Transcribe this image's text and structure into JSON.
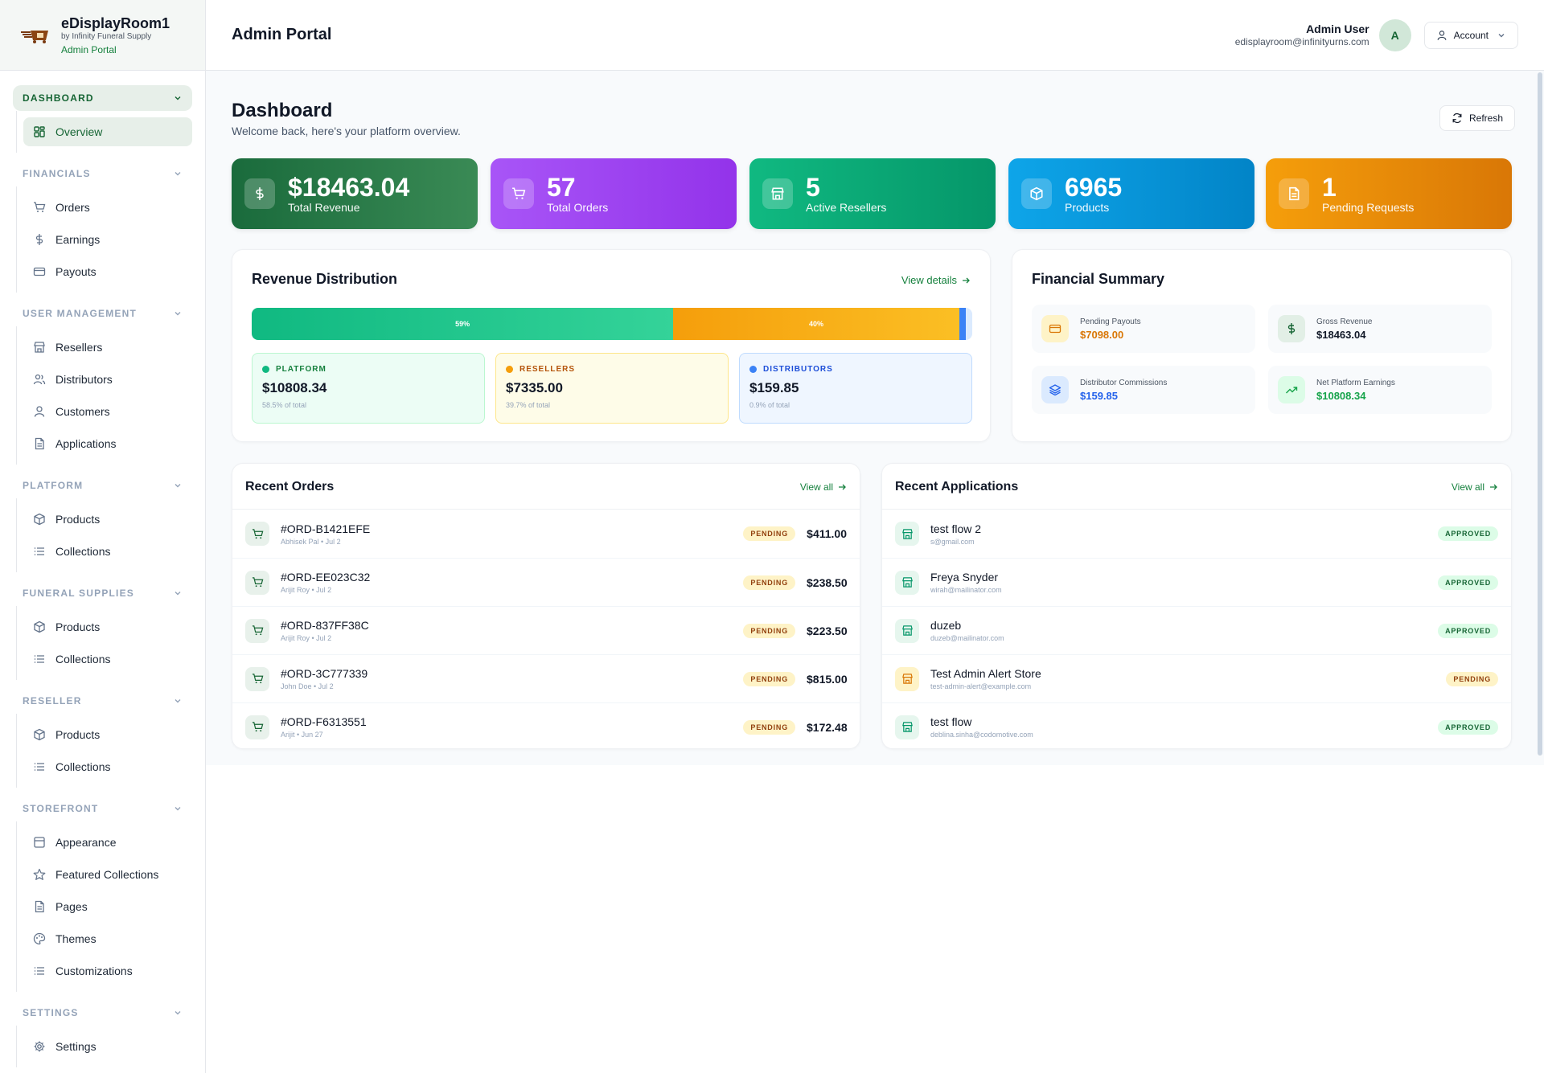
{
  "brand": {
    "title": "eDisplayRoom1",
    "subtitle": "by Infinity Funeral Supply",
    "portal": "Admin Portal"
  },
  "sidebar": {
    "groups": [
      {
        "title": "DASHBOARD",
        "items": [
          {
            "label": "Overview",
            "icon": "grid-icon"
          }
        ]
      },
      {
        "title": "FINANCIALS",
        "items": [
          {
            "label": "Orders",
            "icon": "cart-icon"
          },
          {
            "label": "Earnings",
            "icon": "dollar-icon"
          },
          {
            "label": "Payouts",
            "icon": "card-icon"
          }
        ]
      },
      {
        "title": "USER MANAGEMENT",
        "items": [
          {
            "label": "Resellers",
            "icon": "store-icon"
          },
          {
            "label": "Distributors",
            "icon": "users-icon"
          },
          {
            "label": "Customers",
            "icon": "user-icon"
          },
          {
            "label": "Applications",
            "icon": "document-icon"
          }
        ]
      },
      {
        "title": "PLATFORM",
        "items": [
          {
            "label": "Products",
            "icon": "box-icon"
          },
          {
            "label": "Collections",
            "icon": "list-icon"
          }
        ]
      },
      {
        "title": "FUNERAL SUPPLIES",
        "items": [
          {
            "label": "Products",
            "icon": "box-icon"
          },
          {
            "label": "Collections",
            "icon": "list-icon"
          }
        ]
      },
      {
        "title": "RESELLER",
        "items": [
          {
            "label": "Products",
            "icon": "box-icon"
          },
          {
            "label": "Collections",
            "icon": "list-icon"
          }
        ]
      },
      {
        "title": "STOREFRONT",
        "items": [
          {
            "label": "Appearance",
            "icon": "layout-icon"
          },
          {
            "label": "Featured Collections",
            "icon": "star-icon"
          },
          {
            "label": "Pages",
            "icon": "document-icon"
          },
          {
            "label": "Themes",
            "icon": "palette-icon"
          },
          {
            "label": "Customizations",
            "icon": "list-icon"
          }
        ]
      },
      {
        "title": "SETTINGS",
        "items": [
          {
            "label": "Settings",
            "icon": "gear-icon"
          }
        ]
      }
    ]
  },
  "header": {
    "title": "Admin Portal",
    "user_name": "Admin User",
    "user_email": "edisplayroom@infinityurns.com",
    "avatar_initial": "A",
    "account_label": "Account"
  },
  "page": {
    "title": "Dashboard",
    "subtitle": "Welcome back, here's your platform overview.",
    "refresh_label": "Refresh"
  },
  "stats": [
    {
      "value": "$18463.04",
      "label": "Total Revenue",
      "icon": "dollar-icon",
      "color": "#1f7a45"
    },
    {
      "value": "57",
      "label": "Total Orders",
      "icon": "cart-icon",
      "color": "#9333ea"
    },
    {
      "value": "5",
      "label": "Active Resellers",
      "icon": "store-icon",
      "color": "#10b981"
    },
    {
      "value": "6965",
      "label": "Products",
      "icon": "box-icon",
      "color": "#0ea5e9"
    },
    {
      "value": "1",
      "label": "Pending Requests",
      "icon": "document-icon",
      "color": "#f59e0b"
    }
  ],
  "revenue_distribution": {
    "title": "Revenue Distribution",
    "link": "View details",
    "segments": [
      {
        "label": "59%",
        "fraction": 0.585,
        "color": "#10b981"
      },
      {
        "label": "40%",
        "fraction": 0.397,
        "color": "#f59e0b"
      },
      {
        "label": "",
        "fraction": 0.009,
        "color": "#3b82f6"
      }
    ],
    "boxes": [
      {
        "title": "PLATFORM",
        "amount": "$10808.34",
        "pct": "58.5% of total",
        "color": "#10b981"
      },
      {
        "title": "RESELLERS",
        "amount": "$7335.00",
        "pct": "39.7% of total",
        "color": "#f59e0b"
      },
      {
        "title": "DISTRIBUTORS",
        "amount": "$159.85",
        "pct": "0.9% of total",
        "color": "#3b82f6"
      }
    ]
  },
  "financial_summary": {
    "title": "Financial Summary",
    "items": [
      {
        "label": "Pending Payouts",
        "value": "$7098.00",
        "icon": "card-icon",
        "color": "#d97706"
      },
      {
        "label": "Gross Revenue",
        "value": "$18463.04",
        "icon": "dollar-icon",
        "color": "#111827"
      },
      {
        "label": "Distributor Commissions",
        "value": "$159.85",
        "icon": "layers-icon",
        "color": "#2563eb"
      },
      {
        "label": "Net Platform Earnings",
        "value": "$10808.34",
        "icon": "trending-up-icon",
        "color": "#16a34a"
      }
    ]
  },
  "recent_orders": {
    "title": "Recent Orders",
    "link": "View all",
    "rows": [
      {
        "id": "#ORD-B1421EFE",
        "meta": "Abhisek Pal • Jul 2",
        "status": "PENDING",
        "amount": "$411.00"
      },
      {
        "id": "#ORD-EE023C32",
        "meta": "Arijit Roy • Jul 2",
        "status": "PENDING",
        "amount": "$238.50"
      },
      {
        "id": "#ORD-837FF38C",
        "meta": "Arijit Roy • Jul 2",
        "status": "PENDING",
        "amount": "$223.50"
      },
      {
        "id": "#ORD-3C777339",
        "meta": "John Doe • Jul 2",
        "status": "PENDING",
        "amount": "$815.00"
      },
      {
        "id": "#ORD-F6313551",
        "meta": "Arijit • Jun 27",
        "status": "PENDING",
        "amount": "$172.48"
      }
    ]
  },
  "recent_applications": {
    "title": "Recent Applications",
    "link": "View all",
    "rows": [
      {
        "name": "test flow 2",
        "email": "s@gmail.com",
        "status": "APPROVED"
      },
      {
        "name": "Freya Snyder",
        "email": "wirah@mailinator.com",
        "status": "APPROVED"
      },
      {
        "name": "duzeb",
        "email": "duzeb@mailinator.com",
        "status": "APPROVED"
      },
      {
        "name": "Test Admin Alert Store",
        "email": "test-admin-alert@example.com",
        "status": "PENDING"
      },
      {
        "name": "test flow",
        "email": "deblina.sinha@codomotive.com",
        "status": "APPROVED"
      }
    ]
  }
}
